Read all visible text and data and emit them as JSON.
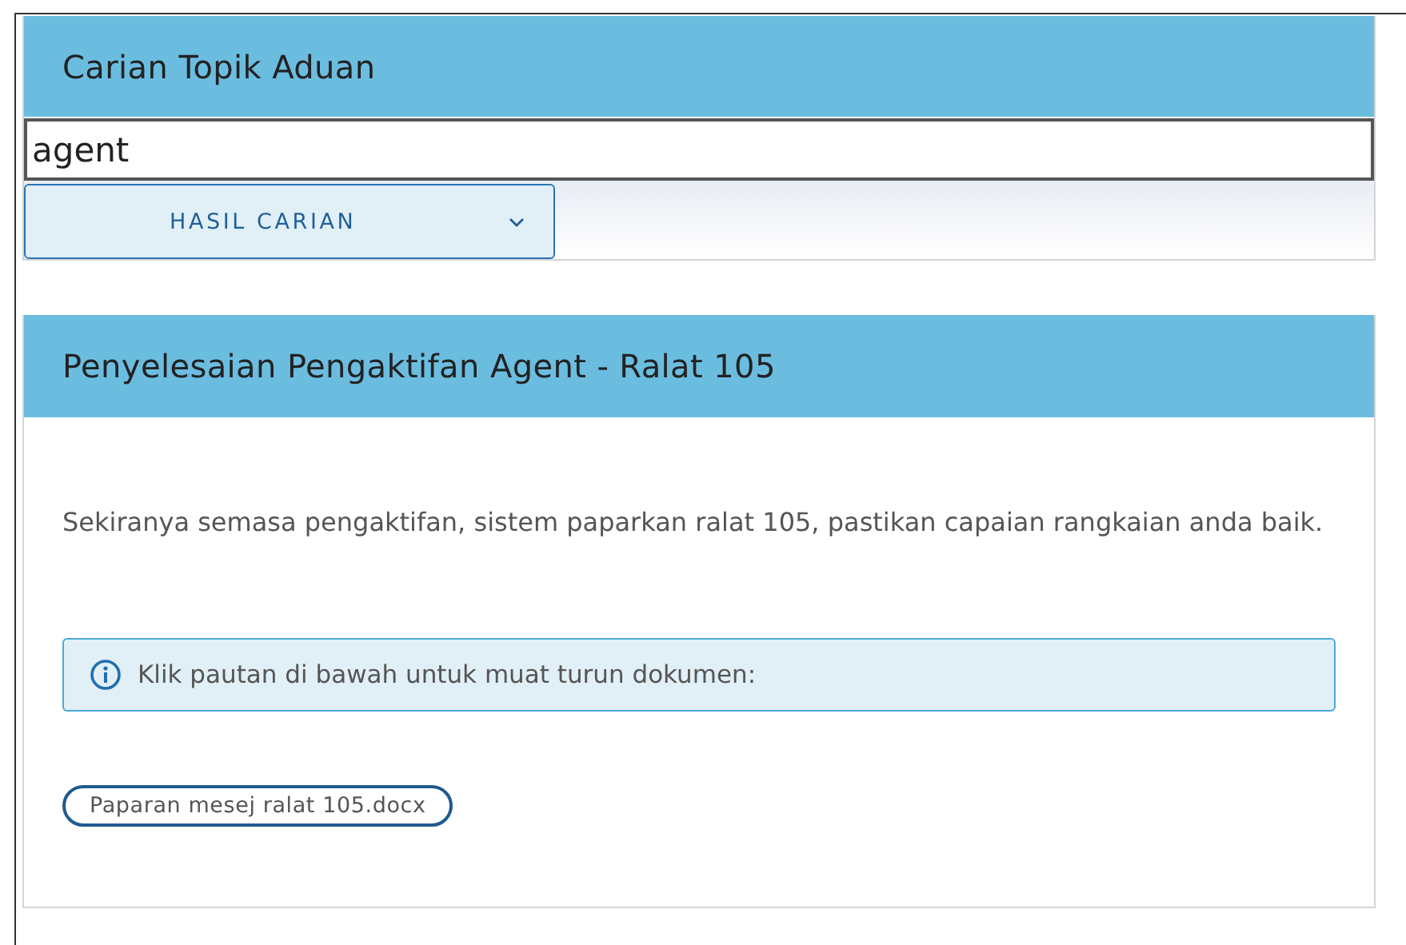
{
  "search_panel": {
    "title": "Carian Topik Aduan",
    "search": {
      "value": "agent"
    },
    "results_button": {
      "label": "HASIL CARIAN"
    }
  },
  "article": {
    "title": "Penyelesaian Pengaktifan Agent - Ralat 105",
    "body": "Sekiranya semasa pengaktifan, sistem paparkan ralat 105, pastikan capaian rangkaian anda baik.",
    "info": "Klik pautan di bawah untuk muat turun dokumen:",
    "attachments": [
      "Paparan mesej ralat 105.docx"
    ]
  }
}
